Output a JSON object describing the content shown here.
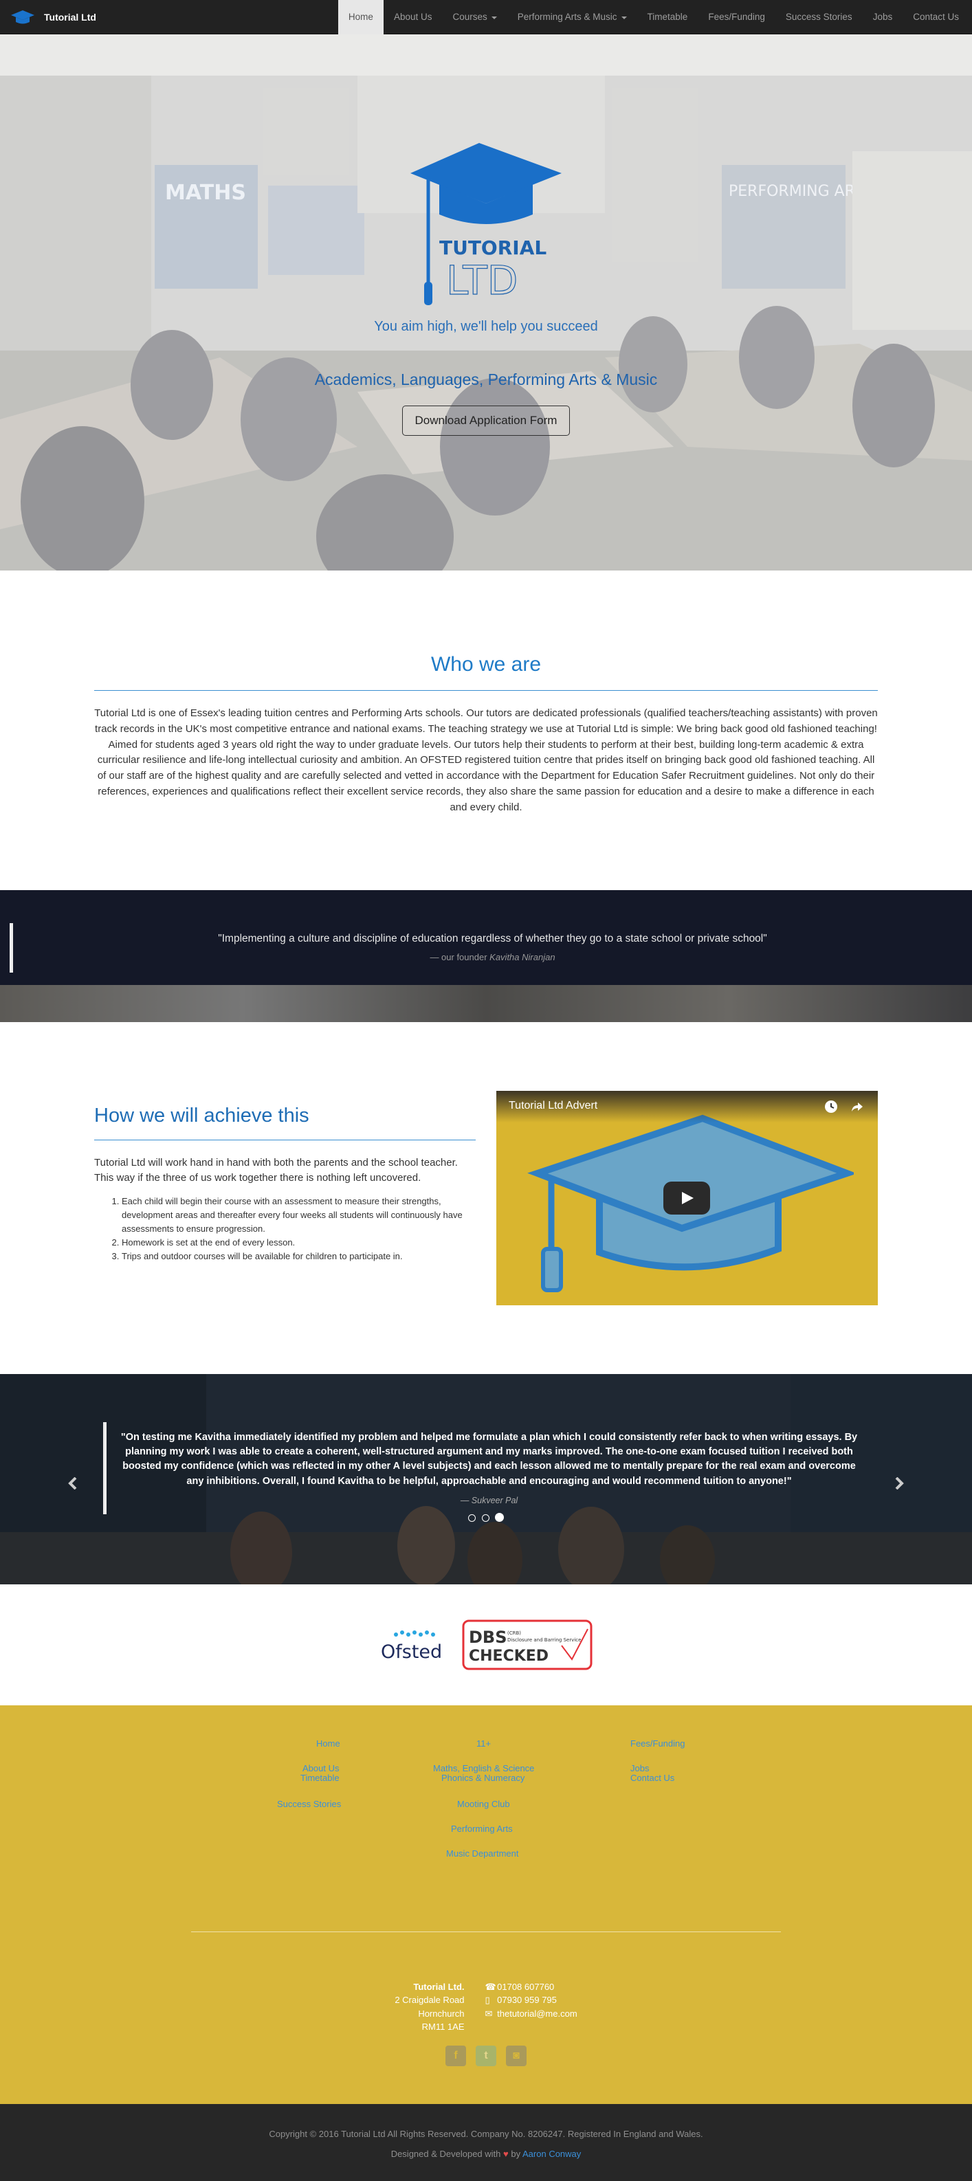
{
  "nav": {
    "brand": "Tutorial Ltd",
    "items": [
      {
        "label": "Home",
        "active": true,
        "dropdown": false
      },
      {
        "label": "About Us",
        "active": false,
        "dropdown": false
      },
      {
        "label": "Courses",
        "active": false,
        "dropdown": true
      },
      {
        "label": "Performing Arts & Music",
        "active": false,
        "dropdown": true
      },
      {
        "label": "Timetable",
        "active": false,
        "dropdown": false
      },
      {
        "label": "Fees/Funding",
        "active": false,
        "dropdown": false
      },
      {
        "label": "Success Stories",
        "active": false,
        "dropdown": false
      },
      {
        "label": "Jobs",
        "active": false,
        "dropdown": false
      },
      {
        "label": "Contact Us",
        "active": false,
        "dropdown": false
      }
    ]
  },
  "hero": {
    "logo_top": "TUTORIAL",
    "logo_bottom": "LTD",
    "tagline": "You aim high, we'll help you succeed",
    "subline": "Academics, Languages, Performing Arts & Music",
    "button": "Download Application Form",
    "wall_label_left": "MATHS",
    "wall_label_right": "PERFORMING ARTS"
  },
  "who": {
    "title": "Who we are",
    "body": "Tutorial Ltd is one of Essex's leading tuition centres and Performing Arts schools. Our tutors are dedicated professionals (qualified teachers/teaching assistants) with proven track records in the UK's most competitive entrance and national exams. The teaching strategy we use at Tutorial Ltd is simple: We bring back good old fashioned teaching! Aimed for students aged 3 years old right the way to under graduate levels. Our tutors help their students to perform at their best, building long-term academic & extra curricular resilience and life-long intellectual curiosity and ambition. An OFSTED registered tuition centre that prides itself on bringing back good old fashioned teaching. All of our staff are of the highest quality and are carefully selected and vetted in accordance with the Department for Education Safer Recruitment guidelines. Not only do their references, experiences and qualifications reflect their excellent service records, they also share the same passion for education and a desire to make a difference in each and every child."
  },
  "quote": {
    "text": "\"Implementing a culture and discipline of education regardless of whether they go to a state school or private school\"",
    "author_prefix": "— our founder ",
    "author_name": "Kavitha Niranjan"
  },
  "how": {
    "title": "How we will achieve this",
    "intro": "Tutorial Ltd will work hand in hand with both the parents and the school teacher. This way if the three of us work together there is nothing left uncovered.",
    "list": [
      "Each child will begin their course with an assessment to measure their strengths, development areas and thereafter every four weeks all students will continuously have assessments to ensure progression.",
      "Homework is set at the end of every lesson.",
      "Trips and outdoor courses will be available for children to participate in."
    ],
    "video_title": "Tutorial Ltd Advert"
  },
  "testimonial": {
    "text": "\"On testing me Kavitha immediately identified my problem and helped me formulate a plan which I could consistently refer back to when writing essays. By planning my work I was able to create a coherent, well-structured argument and my marks improved. The one-to-one exam focused tuition I received both boosted my confidence (which was reflected in my other A level subjects) and each lesson allowed me to mentally prepare for the real exam and overcome any inhibitions. Overall, I found Kavitha to be helpful, approachable and encouraging and would recommend tuition to anyone!\"",
    "author": "— Sukveer Pal",
    "dots": 3,
    "active_dot": 3
  },
  "accreditations": {
    "ofsted": "Ofsted",
    "dbs_title": "DBS",
    "dbs_checked": "CHECKED",
    "dbs_small": "(CRB)",
    "dbs_service": "Disclosure and Barring Service"
  },
  "footer": {
    "links": {
      "home": "Home",
      "about": "About Us",
      "timetable": "Timetable",
      "success": "Success Stories",
      "elevenplus": "11+",
      "mes": "Maths, English & Science",
      "phonics": "Phonics & Numeracy",
      "mooting": "Mooting Club",
      "performing": "Performing Arts",
      "music": "Music Department",
      "fees": "Fees/Funding",
      "jobs": "Jobs",
      "contact": "Contact Us"
    },
    "address": {
      "name": "Tutorial Ltd.",
      "line1": "2 Craigdale Road",
      "line2": "Hornchurch",
      "line3": "RM11 1AE"
    },
    "phone1": "01708 607760",
    "phone2": "07930 959 795",
    "email": "thetutorial@me.com",
    "copyright": "Copyright © 2016 Tutorial Ltd All Rights Reserved. Company No. 8206247. Registered In England and Wales.",
    "credit_prefix": "Designed & Developed with",
    "credit_by": "by",
    "credit_author": "Aaron Conway"
  },
  "colors": {
    "accent_blue": "#1f6db5",
    "footer_gold": "#d8b73a",
    "nav_dark": "#222222",
    "footer_dark": "#272727"
  }
}
